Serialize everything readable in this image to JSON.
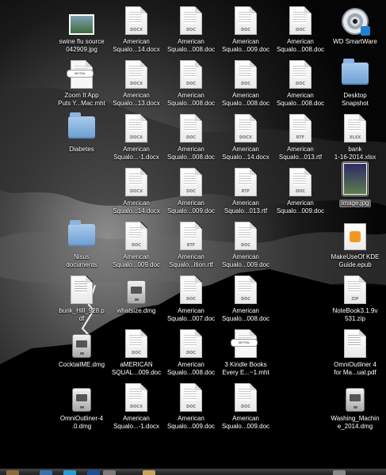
{
  "desktop": {
    "icons": [
      {
        "kind": "photo",
        "label": "swine flu source\n042909.jpg"
      },
      {
        "kind": "doc",
        "ext": "DOCX",
        "label": "American\nSqualo...14.docx"
      },
      {
        "kind": "doc",
        "ext": "DOC",
        "label": "American\nSqualo...008.doc"
      },
      {
        "kind": "doc",
        "ext": "DOC",
        "label": "American\nSqualo...009.doc"
      },
      {
        "kind": "doc",
        "ext": "DOC",
        "label": "American\nSqualo...008.doc"
      },
      {
        "kind": "disc",
        "label": "WD SmartWare"
      },
      {
        "kind": "mht",
        "ext": "MHTML",
        "label": "Zoom It App\nPuts Y...Mac.mht"
      },
      {
        "kind": "doc",
        "ext": "DOCX",
        "label": "American\nSqualo...13.docx"
      },
      {
        "kind": "doc",
        "ext": "DOC",
        "label": "American\nSqualo...008.doc"
      },
      {
        "kind": "doc",
        "ext": "DOC",
        "label": "American\nSqualo...008.doc"
      },
      {
        "kind": "doc",
        "ext": "DOC",
        "label": "American\nSqualo...008.doc"
      },
      {
        "kind": "folder",
        "label": "Desktop\nSnapshot"
      },
      {
        "kind": "folder",
        "label": "Diabetes"
      },
      {
        "kind": "doc",
        "ext": "DOCX",
        "label": "American\nSqualo...-1.docx"
      },
      {
        "kind": "doc",
        "ext": "DOC",
        "label": "American\nSqualo...008.doc"
      },
      {
        "kind": "doc",
        "ext": "DOCX",
        "label": "American\nSqualo...14.docx"
      },
      {
        "kind": "doc",
        "ext": "RTF",
        "label": "American\nSqualo...013.rtf"
      },
      {
        "kind": "doc",
        "ext": "XLSX",
        "label": "bank\n1-16-2014.xlsx"
      },
      {
        "kind": "doc",
        "ext": "DOCX",
        "label": "American\nSqualo...14.docx"
      },
      {
        "kind": "doc",
        "ext": "DOC",
        "label": "American\nSqualo...009.doc"
      },
      {
        "kind": "doc",
        "ext": "RTF",
        "label": "American\nSqualo...013.rtf"
      },
      {
        "kind": "doc",
        "ext": "DOC",
        "label": "American\nSqualo...009.doc"
      },
      {
        "kind": "selected",
        "label": "image.jpg"
      },
      {
        "kind": "folder",
        "label": "Nisus\ndocuments"
      },
      {
        "kind": "doc",
        "ext": "DOC",
        "label": "American\nSqualo...009.doc"
      },
      {
        "kind": "doc",
        "ext": "RTF",
        "label": "American\nSqualo...ition.rtf"
      },
      {
        "kind": "doc",
        "ext": "DOC",
        "label": "American\nSqualo...009.doc"
      },
      {
        "kind": "epub",
        "label": "MakeUseOf KDE\nGuide.epub"
      },
      {
        "kind": "pdf",
        "label": "bunk_Hill_928.p\ndf"
      },
      {
        "kind": "dmg",
        "label": "whatsize.dmg"
      },
      {
        "kind": "doc",
        "ext": "DOC",
        "label": "American\nSqualo...007.doc"
      },
      {
        "kind": "doc",
        "ext": "DOC",
        "label": "American\nSqualo...008.doc"
      },
      {
        "kind": "doc",
        "ext": "ZIP",
        "label": "NoteBook3.1.9v\n531.zip"
      },
      {
        "kind": "dmg",
        "label": "CocktailME.dmg"
      },
      {
        "kind": "doc",
        "ext": "DOC",
        "label": "aMERICAN\nSQUAL...009.doc"
      },
      {
        "kind": "doc",
        "ext": "DOC",
        "label": "American\nSqualo...008.doc"
      },
      {
        "kind": "mht",
        "ext": "MHTML",
        "label": "3 Kindle Books\nEvery E...~1.mht"
      },
      {
        "kind": "pdf",
        "label": "OmniOutliner 4\nfor Ma...ual.pdf"
      },
      {
        "kind": "dmg",
        "label": "OmniOutliner-4\n.0.dmg"
      },
      {
        "kind": "doc",
        "ext": "DOCX",
        "label": "American\nSqualo...-1.docx"
      },
      {
        "kind": "doc",
        "ext": "DOC",
        "label": "American\nSqualo...009.doc"
      },
      {
        "kind": "doc",
        "ext": "DOC",
        "label": "American\nSqualo...009.doc"
      },
      {
        "kind": "dmg",
        "label": "Washing_Machin\ne_2014.dmg"
      }
    ]
  },
  "colors": {
    "selection": "#6f6f6f",
    "label": "#ffffff"
  }
}
